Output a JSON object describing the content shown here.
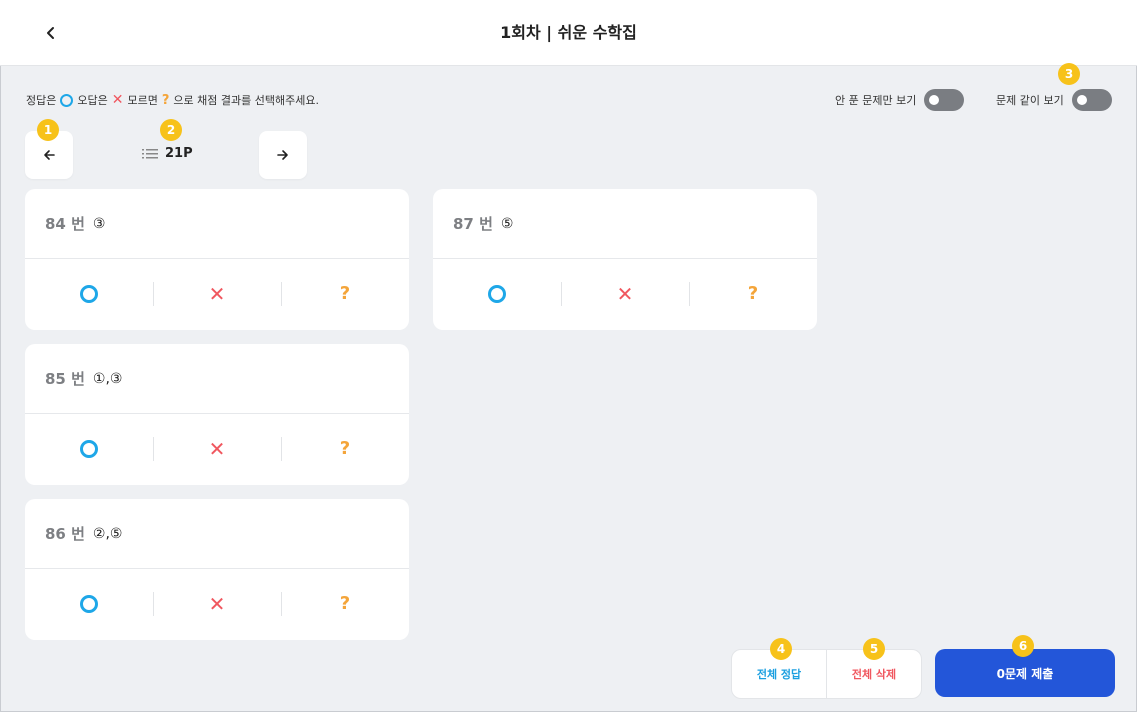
{
  "header": {
    "title": "1회차 | 쉬운 수학집",
    "back_icon": "chevron-left-icon"
  },
  "instruction": {
    "part1": "정답은",
    "part2": "오답은",
    "part3": "모르면",
    "part4": "으로 채점 결과를 선택해주세요.",
    "correct_symbol": "○",
    "wrong_symbol": "✕",
    "unknown_symbol": "?"
  },
  "toggles": {
    "unsolved_only_label": "안 푼 문제만 보기",
    "unsolved_only_on": false,
    "show_with_problem_label": "문제 같이 보기",
    "show_with_problem_on": false
  },
  "page_nav": {
    "current_page": "21P",
    "prev_icon": "arrow-left-icon",
    "next_icon": "arrow-right-icon",
    "list_icon": "list-icon"
  },
  "badges": [
    "1",
    "2",
    "3",
    "4",
    "5",
    "6"
  ],
  "questions": [
    {
      "number": "84 번",
      "answer": "③"
    },
    {
      "number": "87 번",
      "answer": "⑤"
    },
    {
      "number": "85 번",
      "answer": "①,③"
    },
    {
      "number": "86 번",
      "answer": "②,⑤"
    }
  ],
  "mark_symbols": {
    "correct": "",
    "wrong": "✕",
    "unknown": "?"
  },
  "actions": {
    "all_correct_label": "전체 정답",
    "delete_all_label": "전체 삭제",
    "submit_label": "0문제 제출"
  },
  "colors": {
    "correct": "#1ea7e8",
    "wrong": "#f0575f",
    "unknown": "#f4a53a",
    "badge": "#f7c21a",
    "submit": "#2356d9",
    "all_correct_text": "#1b9fe0",
    "delete_all_text": "#f0575f"
  }
}
